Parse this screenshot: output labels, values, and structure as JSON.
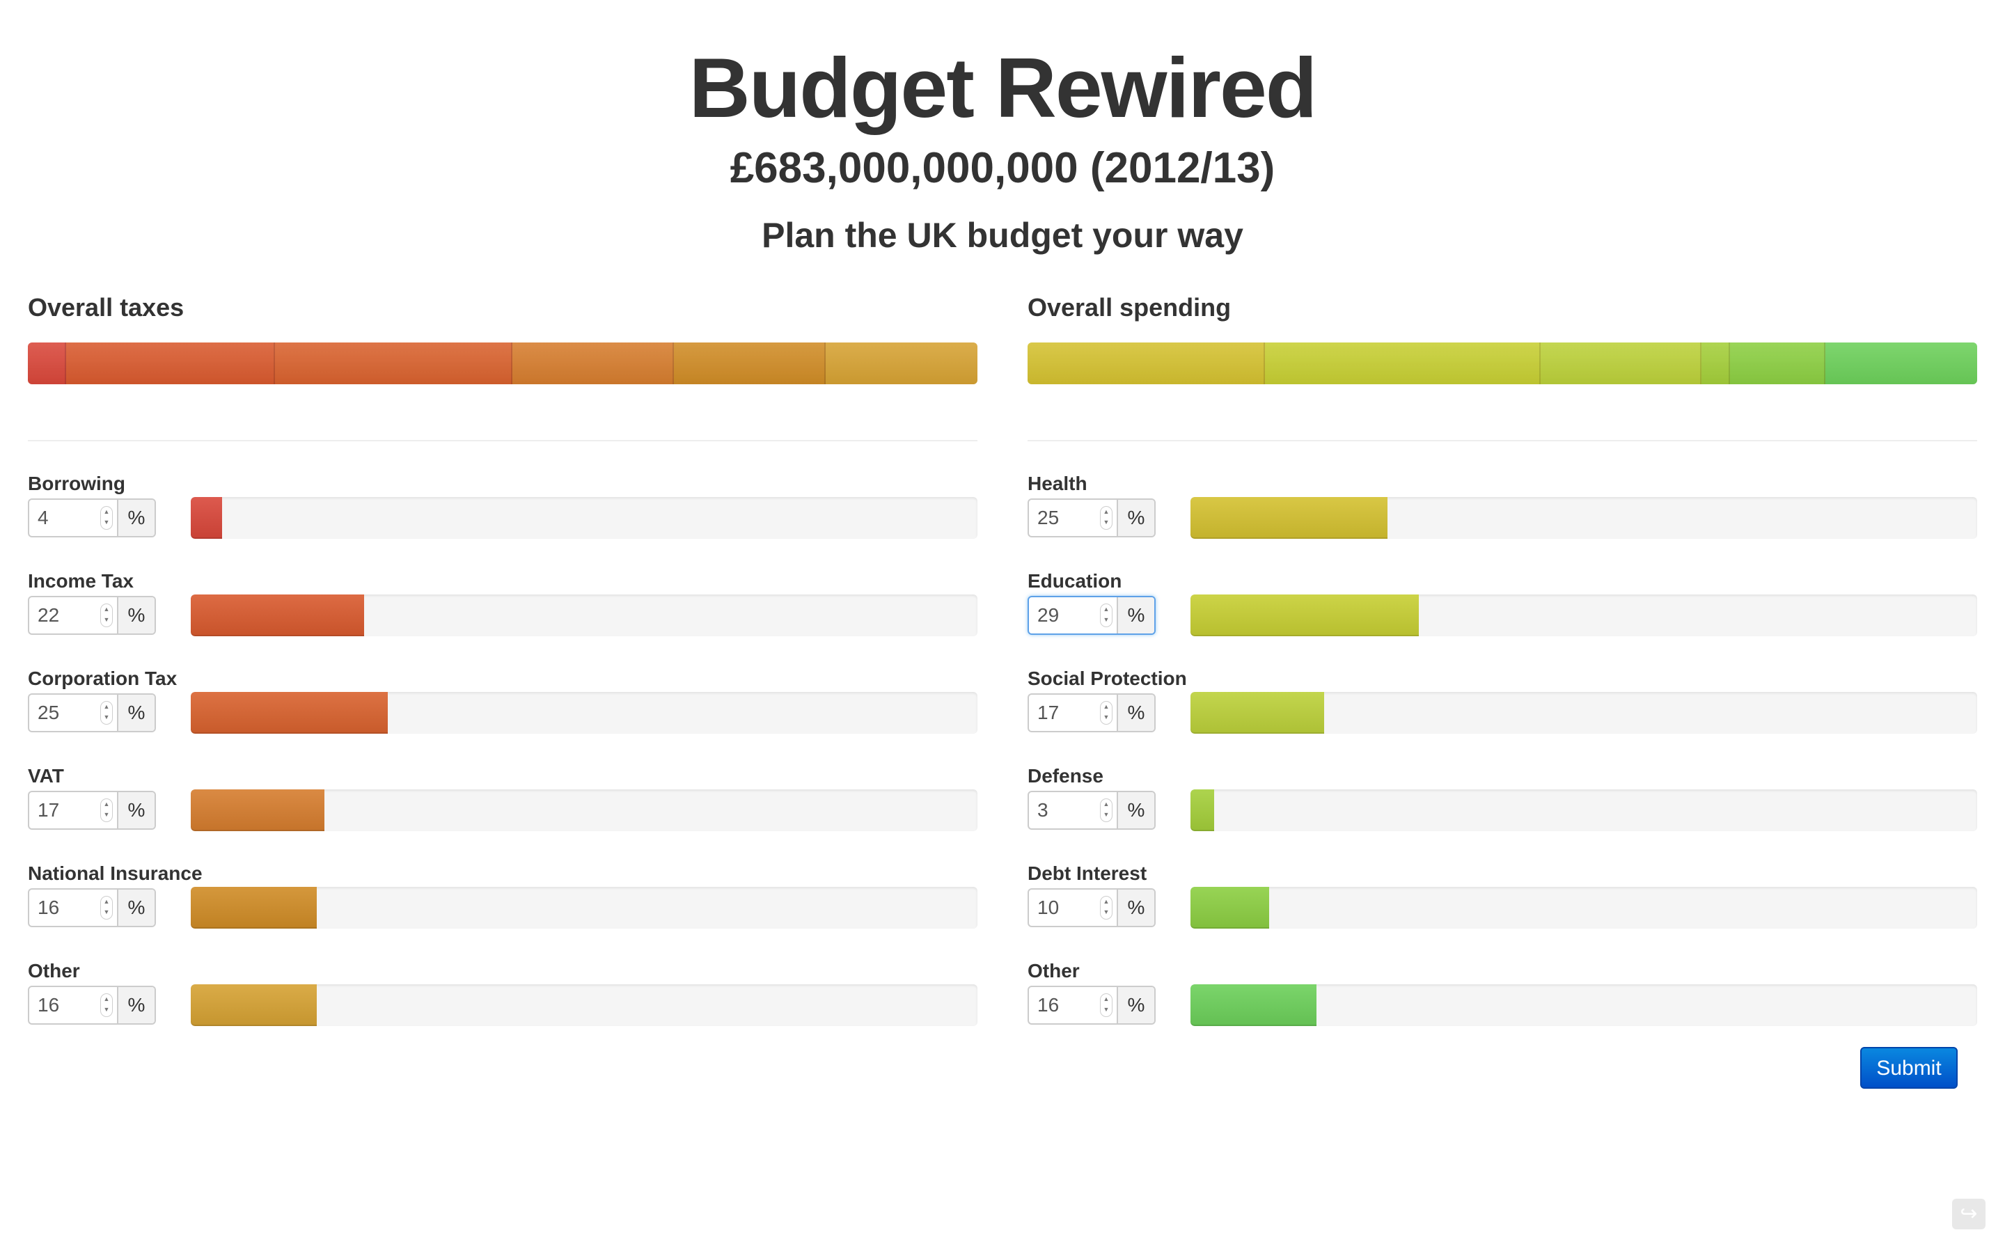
{
  "header": {
    "title": "Budget Rewired",
    "total": "£683,000,000,000 (2012/13)",
    "tagline": "Plan the UK budget your way"
  },
  "taxes": {
    "title": "Overall taxes",
    "unit": "%",
    "items": [
      {
        "label": "Borrowing",
        "value": "4",
        "color": "#d9473a"
      },
      {
        "label": "Income Tax",
        "value": "22",
        "color": "#d95a2e"
      },
      {
        "label": "Corporation Tax",
        "value": "25",
        "color": "#d9622e"
      },
      {
        "label": "VAT",
        "value": "17",
        "color": "#d67d2e"
      },
      {
        "label": "National Insurance",
        "value": "16",
        "color": "#d08c26"
      },
      {
        "label": "Other",
        "value": "16",
        "color": "#d6a233"
      }
    ]
  },
  "spending": {
    "title": "Overall spending",
    "unit": "%",
    "items": [
      {
        "label": "Health",
        "value": "25",
        "color": "#d4c130"
      },
      {
        "label": "Education",
        "value": "29",
        "color": "#c7cf33",
        "focused": true
      },
      {
        "label": "Social Protection",
        "value": "17",
        "color": "#bcd13a"
      },
      {
        "label": "Defense",
        "value": "3",
        "color": "#a4cf3a"
      },
      {
        "label": "Debt Interest",
        "value": "10",
        "color": "#8ccf42"
      },
      {
        "label": "Other",
        "value": "16",
        "color": "#6cd05a"
      }
    ]
  },
  "actions": {
    "submit_label": "Submit"
  },
  "icons": {
    "stepper": "stepper-arrows-icon",
    "share": "share-icon"
  }
}
